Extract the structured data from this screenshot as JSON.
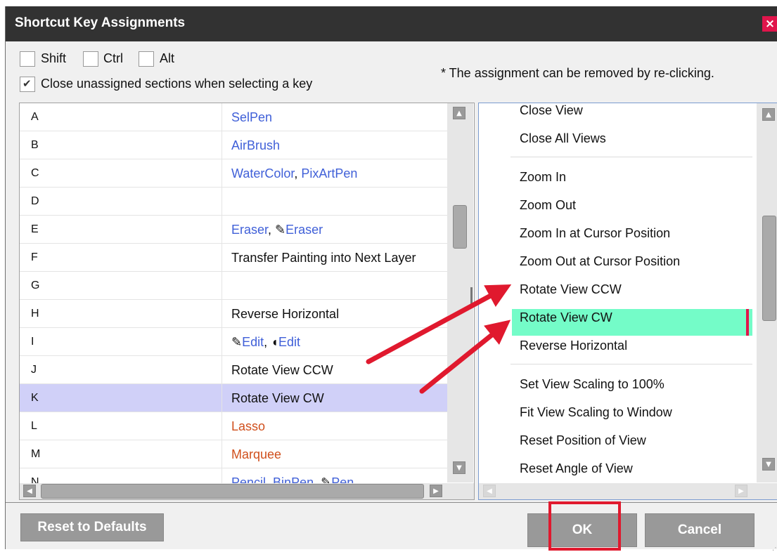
{
  "title": "Shortcut Key Assignments",
  "close_glyph": "×",
  "modifiers": [
    {
      "label": "Shift",
      "checked": false
    },
    {
      "label": "Ctrl",
      "checked": false
    },
    {
      "label": "Alt",
      "checked": false
    }
  ],
  "close_unassigned": {
    "label": "Close unassigned sections when selecting a key",
    "checked": true
  },
  "note": "* The assignment can be removed by re-clicking.",
  "keys": [
    {
      "key": "A",
      "parts": [
        {
          "text": "SelPen",
          "color": "blue"
        }
      ]
    },
    {
      "key": "B",
      "parts": [
        {
          "text": "AirBrush",
          "color": "blue"
        }
      ]
    },
    {
      "key": "C",
      "parts": [
        {
          "text": "WaterColor",
          "color": "blue"
        },
        {
          "text": ", ",
          "color": "black"
        },
        {
          "text": "PixArtPen",
          "color": "blue"
        }
      ]
    },
    {
      "key": "D",
      "parts": []
    },
    {
      "key": "E",
      "parts": [
        {
          "text": "Eraser",
          "color": "blue"
        },
        {
          "text": ", ",
          "color": "black"
        },
        {
          "text": "✎",
          "color": "black"
        },
        {
          "text": "Eraser",
          "color": "blue"
        }
      ]
    },
    {
      "key": "F",
      "parts": [
        {
          "text": "Transfer Painting into Next Layer",
          "color": "black"
        }
      ]
    },
    {
      "key": "G",
      "parts": []
    },
    {
      "key": "H",
      "parts": [
        {
          "text": "Reverse Horizontal",
          "color": "black"
        }
      ]
    },
    {
      "key": "I",
      "parts": [
        {
          "text": "✎",
          "color": "black"
        },
        {
          "text": "Edit",
          "color": "blue"
        },
        {
          "text": ", ",
          "color": "black"
        },
        {
          "text": "◖",
          "color": "black"
        },
        {
          "text": "Edit",
          "color": "blue"
        }
      ]
    },
    {
      "key": "J",
      "parts": [
        {
          "text": "Rotate View CCW",
          "color": "black"
        }
      ]
    },
    {
      "key": "K",
      "parts": [
        {
          "text": "Rotate View CW",
          "color": "black"
        }
      ],
      "selected": true
    },
    {
      "key": "L",
      "parts": [
        {
          "text": "Lasso",
          "color": "orange"
        }
      ]
    },
    {
      "key": "M",
      "parts": [
        {
          "text": "Marquee",
          "color": "orange"
        }
      ]
    },
    {
      "key": "N",
      "parts": [
        {
          "text": "Pencil",
          "color": "blue"
        },
        {
          "text": ", ",
          "color": "black"
        },
        {
          "text": "BinPen",
          "color": "blue"
        },
        {
          "text": ", ",
          "color": "black"
        },
        {
          "text": "✎",
          "color": "black"
        },
        {
          "text": "Pen",
          "color": "blue"
        }
      ]
    }
  ],
  "functions": [
    {
      "label": "Close View"
    },
    {
      "label": "Close All Views",
      "divider_after": true
    },
    {
      "label": "Zoom In"
    },
    {
      "label": "Zoom Out"
    },
    {
      "label": "Zoom In at Cursor Position"
    },
    {
      "label": "Zoom Out at Cursor Position"
    },
    {
      "label": "Rotate View CCW"
    },
    {
      "label": "Rotate View CW",
      "highlighted": true
    },
    {
      "label": "Reverse Horizontal",
      "divider_after": true
    },
    {
      "label": "Set View Scaling to 100%"
    },
    {
      "label": "Fit View Scaling to Window"
    },
    {
      "label": "Reset Position of View"
    },
    {
      "label": "Reset Angle of View"
    }
  ],
  "buttons": {
    "reset": "Reset to Defaults",
    "ok": "OK",
    "cancel": "Cancel"
  },
  "colors": {
    "title_bar": "#323232",
    "close_button": "#e0154b",
    "highlight": "#74fcc8",
    "selected_row": "#d0d0f8",
    "link_blue": "#4060d8",
    "tool_orange": "#d04f1c",
    "annotation_red": "#e0192e"
  }
}
